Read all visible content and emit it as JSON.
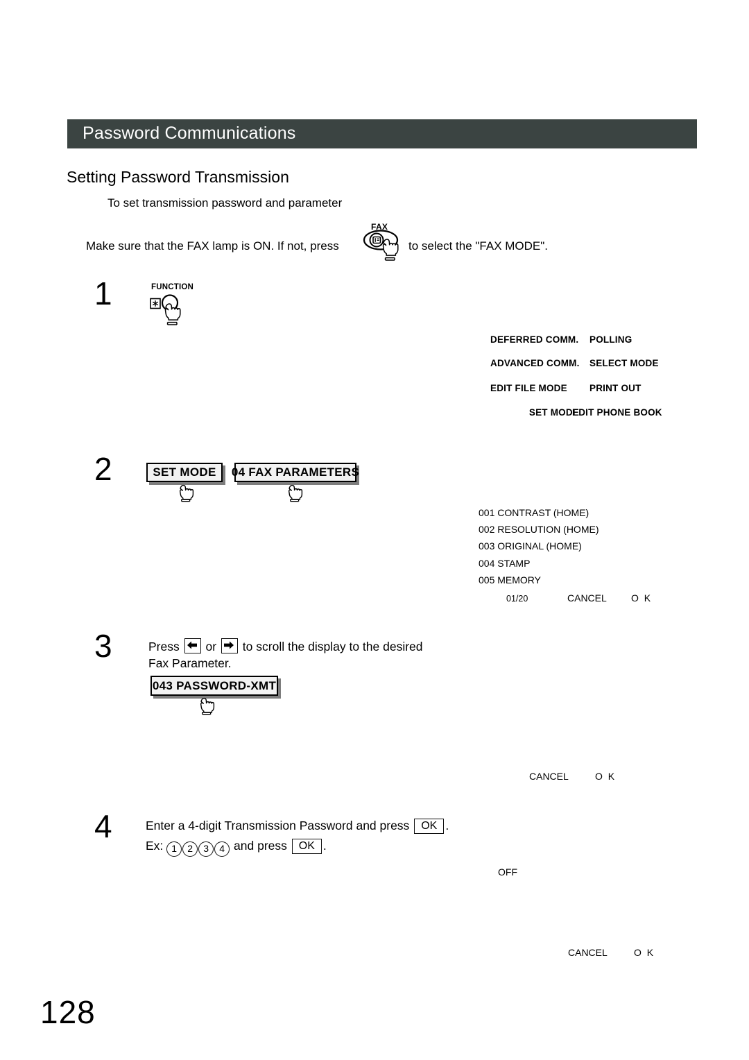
{
  "header": {
    "title": "Password Communications"
  },
  "section": {
    "heading": "Setting  Password Transmission",
    "subtitle": "To set transmission password and parameter"
  },
  "intro": {
    "text_before": "Make sure that the FAX lamp is ON.  If not, press",
    "text_after": "to select the \"FAX MODE\".",
    "fax_key_label": "FAX",
    "fax_key_icon": "fax-machine-icon"
  },
  "steps": [
    {
      "number": "1",
      "key_label": "FUNCTION",
      "asterisk_key_icon": "asterisk-key-icon",
      "hand_icon": "pointing-hand-icon"
    },
    {
      "number": "2",
      "buttons": [
        {
          "label": "SET MODE"
        },
        {
          "label": "04 FAX PARAMETERS"
        }
      ]
    },
    {
      "number": "3",
      "line1_before": "Press",
      "line1_middle": "or",
      "line1_after": "to scroll the display to the desired",
      "line2": "Fax Parameter.",
      "left_arrow_icon": "arrow-left-key-icon",
      "right_arrow_icon": "arrow-right-key-icon",
      "button_label": "043 PASSWORD-XMT"
    },
    {
      "number": "4",
      "line1_before": "Enter a 4-digit Transmission Password and press",
      "line1_key": "OK",
      "line1_after": ".",
      "line2_before": "Ex:",
      "line2_digits": [
        "1",
        "2",
        "3",
        "4"
      ],
      "line2_middle": "and press",
      "line2_key": "OK",
      "line2_after": "."
    }
  ],
  "lcd_menu": {
    "rows": [
      {
        "left": "DEFERRED COMM.",
        "right": "POLLING"
      },
      {
        "left": "ADVANCED COMM.",
        "right": "SELECT MODE"
      },
      {
        "left": "EDIT FILE MODE",
        "right": "PRINT OUT"
      },
      {
        "left": "SET MODE",
        "right": "EDIT PHONE BOOK"
      }
    ]
  },
  "lcd_params": {
    "items": [
      "001 CONTRAST (HOME)",
      "002 RESOLUTION (HOME)",
      "003 ORIGINAL (HOME)",
      "004 STAMP",
      "005 MEMORY"
    ],
    "page_indicator": "01/20",
    "cancel_label": "CANCEL",
    "ok_label": "O K"
  },
  "lcd_fragments": {
    "mid": {
      "cancel_label": "CANCEL",
      "ok_label": "O K"
    },
    "off_value": "OFF",
    "bottom": {
      "cancel_label": "CANCEL",
      "ok_label": "O K"
    }
  },
  "footer": {
    "page_number": "128"
  }
}
